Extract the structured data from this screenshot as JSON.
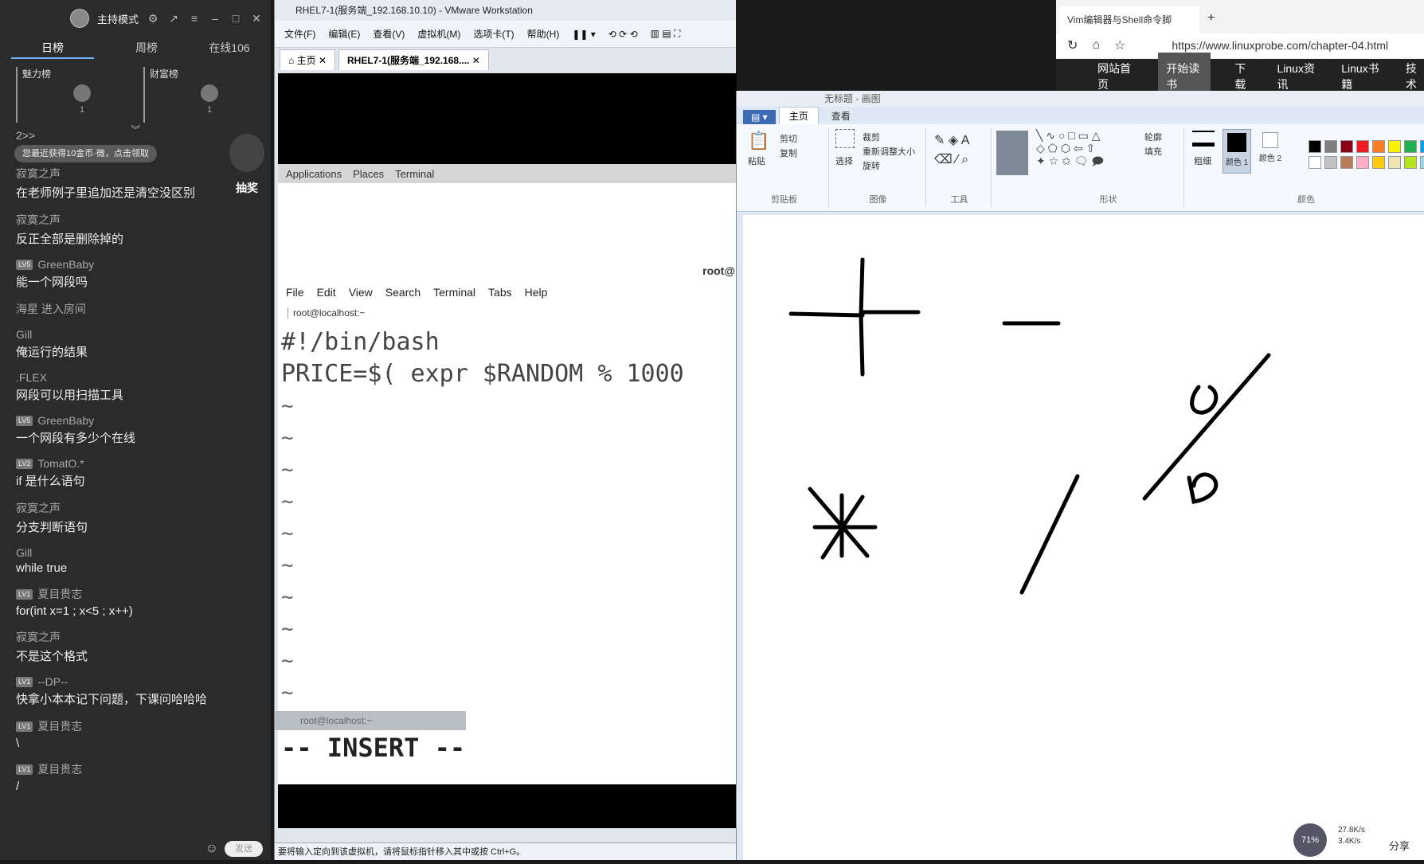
{
  "live": {
    "mode_label": "主持模式",
    "tabs": [
      {
        "label": "日榜"
      },
      {
        "label": "周榜"
      },
      {
        "label": "在线106"
      }
    ],
    "rank_cards": [
      {
        "title": "魅力榜",
        "count": "1"
      },
      {
        "title": "财富榜",
        "count": "1"
      }
    ],
    "system_line": "2>>",
    "pill": "您最近获得10金币·微，点击领取",
    "lottery": "抽奖",
    "messages": [
      {
        "user": "寂寞之声",
        "lv": "",
        "text": "在老师例子里追加还是清空没区别"
      },
      {
        "user": "寂寞之声",
        "lv": "",
        "text": "反正全部是删除掉的"
      },
      {
        "user": "GreenBaby",
        "lv": "LV5",
        "text": "能一个网段吗"
      },
      {
        "user": "海星 进入房间",
        "lv": "",
        "text": ""
      },
      {
        "user": "Gill",
        "lv": "",
        "text": "俺运行的结果"
      },
      {
        "user": ".FLEX",
        "lv": "",
        "text": "网段可以用扫描工具"
      },
      {
        "user": "GreenBaby",
        "lv": "LV5",
        "text": "一个网段有多少个在线"
      },
      {
        "user": "TomatO.*",
        "lv": "LV2",
        "text": "if 是什么语句"
      },
      {
        "user": "寂寞之声",
        "lv": "",
        "text": "分支判断语句"
      },
      {
        "user": "Gill",
        "lv": "",
        "text": "while true"
      },
      {
        "user": "夏目贵志",
        "lv": "LV1",
        "text": "for(int x=1 ; x<5 ; x++)"
      },
      {
        "user": "寂寞之声",
        "lv": "",
        "text": "不是这个格式"
      },
      {
        "user": "--DP--",
        "lv": "LV1",
        "text": "快拿小本本记下问题，下课问哈哈哈"
      },
      {
        "user": "夏目贵志",
        "lv": "LV1",
        "text": "\\"
      },
      {
        "user": "夏目贵志",
        "lv": "LV1",
        "text": "/"
      }
    ],
    "send_label": "发送"
  },
  "vmware": {
    "title": "RHEL7-1(服务端_192.168.10.10) - VMware Workstation",
    "menu": [
      "文件(F)",
      "编辑(E)",
      "查看(V)",
      "虚拟机(M)",
      "选项卡(T)",
      "帮助(H)"
    ],
    "tabs": [
      {
        "label": "主页"
      },
      {
        "label": "RHEL7-1(服务端_192.168...."
      }
    ],
    "gnome": {
      "applications": "Applications",
      "places": "Places",
      "terminal": "Terminal"
    },
    "term_host": "root@",
    "term_menu": [
      "File",
      "Edit",
      "View",
      "Search",
      "Terminal",
      "Tabs",
      "Help"
    ],
    "term_tab": "root@localhost:~",
    "lines": [
      "#!/bin/bash",
      "PRICE=$( expr $RANDOM % 1000"
    ],
    "tilde": "~",
    "mode": "-- INSERT --",
    "taskbar": "root@localhost:~",
    "status": "要将输入定向到该虚拟机，请将鼠标指针移入其中或按 Ctrl+G。"
  },
  "browser": {
    "tab_title": "Vim编辑器与Shell命令脚",
    "url": "https://www.linuxprobe.com/chapter-04.html",
    "nav": [
      "网站首页",
      "开始读书",
      "下载",
      "Linux资讯",
      "Linux书籍",
      "技术"
    ]
  },
  "paint": {
    "title": "无标题 - 画图",
    "tabs": {
      "file": "▤ ▾",
      "home": "主页",
      "view": "查看"
    },
    "groups": [
      {
        "label": "剪贴板",
        "items": [
          "粘贴",
          "剪切",
          "复制"
        ]
      },
      {
        "label": "图像",
        "items": [
          "选择",
          "裁剪",
          "重新调整大小",
          "旋转"
        ]
      },
      {
        "label": "工具",
        "items": []
      },
      {
        "label": "形状",
        "items": [
          "轮廓",
          "填充"
        ]
      },
      {
        "label": "颜色",
        "items": [
          "粗细",
          "颜色 1",
          "颜色 2"
        ]
      }
    ],
    "colors": [
      "#000000",
      "#7f7f7f",
      "#880015",
      "#ed1c24",
      "#ff7f27",
      "#fff200",
      "#22b14c",
      "#00a2e8",
      "#ffffff",
      "#c3c3c3",
      "#b97a57",
      "#ffaec9",
      "#ffc90e",
      "#efe4b0",
      "#b5e61d",
      "#99d9ea"
    ]
  },
  "tray": {
    "speed_up": "27.8K/s",
    "speed_down": "3.4K/s",
    "share": "分享",
    "ball": "71%"
  }
}
